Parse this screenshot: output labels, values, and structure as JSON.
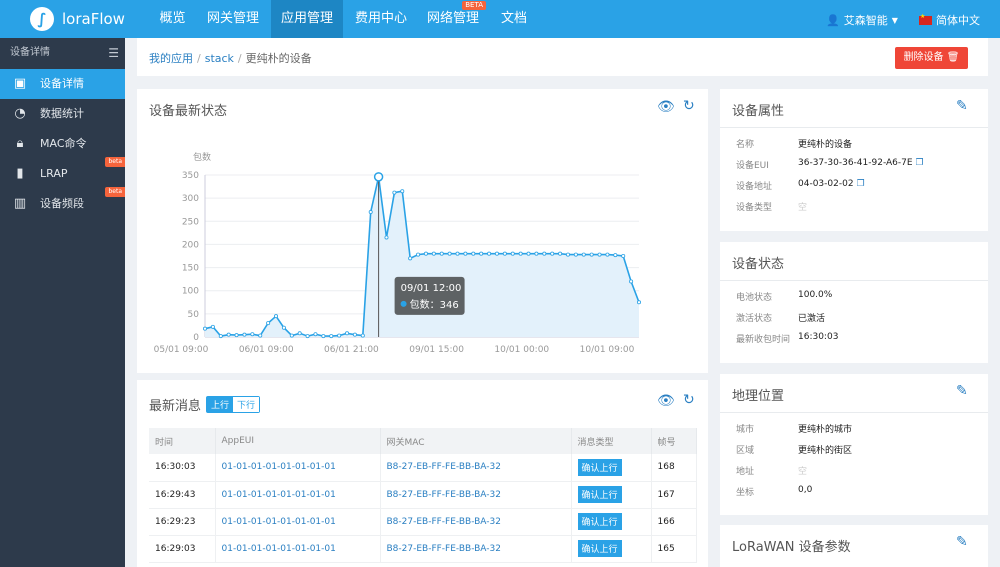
{
  "nav": {
    "logo_letter": "∫",
    "logo_text": "loraFlow",
    "items": [
      {
        "label": "概览"
      },
      {
        "label": "网关管理"
      },
      {
        "label": "应用管理"
      },
      {
        "label": "费用中心"
      },
      {
        "label": "网络管理"
      },
      {
        "label": "文档"
      }
    ],
    "beta_label": "BETA",
    "user_name": "艾森智能",
    "language": "简体中文"
  },
  "sidebar": {
    "header": "设备详情",
    "items": [
      {
        "label": "设备详情",
        "icon": "monitor-icon"
      },
      {
        "label": "数据统计",
        "icon": "pie-chart-icon"
      },
      {
        "label": "MAC命令",
        "icon": "lock-icon"
      },
      {
        "label": "LRAP",
        "icon": "device-icon",
        "badge": "beta"
      },
      {
        "label": "设备频段",
        "icon": "bars-icon",
        "badge": "beta"
      }
    ]
  },
  "breadcrumb": {
    "items": [
      "我的应用",
      "stack",
      "更纯朴的设备"
    ],
    "delete_button": "删除设备 🗑"
  },
  "status_card": {
    "title": "设备最新状态",
    "tooltip_title": "09/01 12:00",
    "tooltip_label": "包数：346"
  },
  "chart_data": {
    "type": "area",
    "ylabel": "包数",
    "ylim": [
      0,
      350
    ],
    "yticks": [
      0,
      50,
      100,
      150,
      200,
      250,
      300,
      350
    ],
    "xtick_labels": [
      "05/01 09:00",
      "06/01 09:00",
      "06/01 21:00",
      "09/01 15:00",
      "10/01 00:00",
      "10/01 09:00"
    ],
    "values": [
      18,
      22,
      2,
      5,
      4,
      5,
      6,
      3,
      30,
      45,
      20,
      3,
      8,
      2,
      6,
      2,
      2,
      3,
      8,
      5,
      3,
      270,
      346,
      215,
      312,
      315,
      170,
      178,
      180,
      180,
      180,
      180,
      180,
      180,
      180,
      180,
      180,
      180,
      180,
      180,
      180,
      180,
      180,
      180,
      180,
      180,
      178,
      178,
      178,
      178,
      178,
      178,
      177,
      175,
      120,
      75
    ],
    "color": "#2aa2e6",
    "fill": "#e3f1fb"
  },
  "messages_card": {
    "title": "最新消息",
    "tabs": [
      "上行",
      "下行"
    ],
    "columns": [
      "时间",
      "AppEUI",
      "网关MAC",
      "消息类型",
      "帧号"
    ],
    "rows": [
      {
        "time": "16:30:03",
        "appeui": "01-01-01-01-01-01-01-01",
        "mac": "B8-27-EB-FF-FE-BB-BA-32",
        "type": "确认上行",
        "frame": "168"
      },
      {
        "time": "16:29:43",
        "appeui": "01-01-01-01-01-01-01-01",
        "mac": "B8-27-EB-FF-FE-BB-BA-32",
        "type": "确认上行",
        "frame": "167"
      },
      {
        "time": "16:29:23",
        "appeui": "01-01-01-01-01-01-01-01",
        "mac": "B8-27-EB-FF-FE-BB-BA-32",
        "type": "确认上行",
        "frame": "166"
      },
      {
        "time": "16:29:03",
        "appeui": "01-01-01-01-01-01-01-01",
        "mac": "B8-27-EB-FF-FE-BB-BA-32",
        "type": "确认上行",
        "frame": "165"
      }
    ]
  },
  "properties_card": {
    "title": "设备属性",
    "rows": [
      {
        "label": "名称",
        "value": "更纯朴的设备"
      },
      {
        "label": "设备EUI",
        "value": "36-37-30-36-41-92-A6-7E"
      },
      {
        "label": "设备地址",
        "value": "04-03-02-02"
      },
      {
        "label": "设备类型",
        "value": "空"
      }
    ]
  },
  "device_status_card": {
    "title": "设备状态",
    "rows": [
      {
        "label": "电池状态",
        "value": "100.0%"
      },
      {
        "label": "激活状态",
        "value": "已激活"
      },
      {
        "label": "最新收包时间",
        "value": "16:30:03"
      }
    ]
  },
  "location_card": {
    "title": "地理位置",
    "rows": [
      {
        "label": "城市",
        "value": "更纯朴的城市"
      },
      {
        "label": "区域",
        "value": "更纯朴的街区"
      },
      {
        "label": "地址",
        "value": "空"
      },
      {
        "label": "坐标",
        "value": "0,0"
      }
    ]
  },
  "lorawan_card": {
    "title": "LoRaWAN 设备参数"
  }
}
